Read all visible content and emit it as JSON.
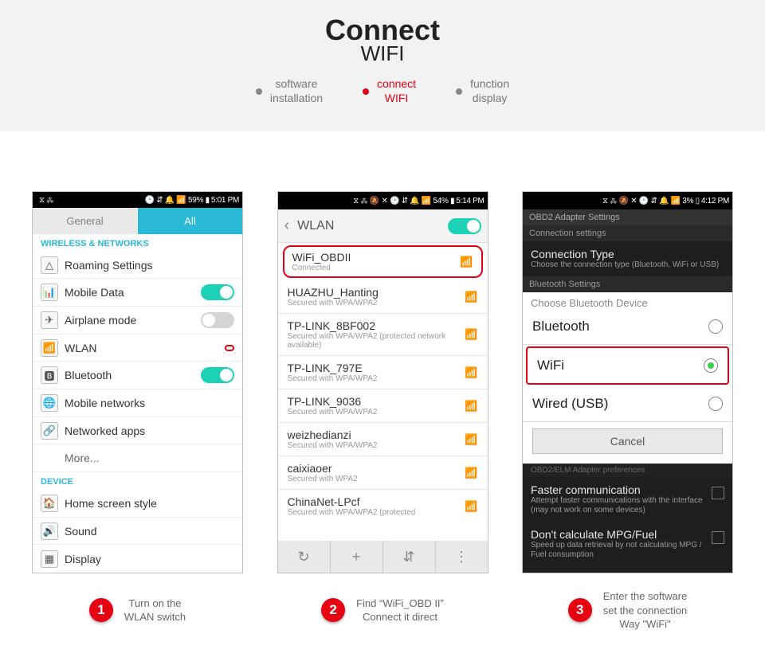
{
  "banner": {
    "title": "Connect",
    "subtitle": "WIFI"
  },
  "bullets": [
    {
      "l1": "software",
      "l2": "installation",
      "active": false
    },
    {
      "l1": "connect",
      "l2": "WIFI",
      "active": true
    },
    {
      "l1": "function",
      "l2": "display",
      "active": false
    }
  ],
  "phone1": {
    "status": {
      "icons": "⧖ ⁂",
      "right": "🕑 ⇵ 🔔 📶 59% ▮",
      "time": "5:01 PM"
    },
    "tabs": {
      "left": "General",
      "right": "All"
    },
    "section1": "WIRELESS & NETWORKS",
    "rows": [
      {
        "icon": "△",
        "label": "Roaming Settings",
        "toggle": null
      },
      {
        "icon": "📊",
        "label": "Mobile Data",
        "toggle": "on"
      },
      {
        "icon": "✈",
        "label": "Airplane mode",
        "toggle": "off"
      },
      {
        "icon": "📶",
        "label": "WLAN",
        "toggle": "on",
        "highlight": true
      },
      {
        "icon": "🅱",
        "label": "Bluetooth",
        "toggle": "on"
      },
      {
        "icon": "🌐",
        "label": "Mobile networks",
        "toggle": null
      },
      {
        "icon": "🔗",
        "label": "Networked apps",
        "toggle": null
      }
    ],
    "more": "More...",
    "section2": "DEVICE",
    "rows2": [
      {
        "icon": "🏠",
        "label": "Home screen style"
      },
      {
        "icon": "🔊",
        "label": "Sound"
      },
      {
        "icon": "▦",
        "label": "Display"
      }
    ]
  },
  "phone2": {
    "status": {
      "right": "⧖ ⁂ 🔕 ✕ 🕑 ⇵ 🔔 📶 54% ▮",
      "time": "5:14 PM"
    },
    "head": {
      "back": "‹",
      "title": "WLAN"
    },
    "first": {
      "name": "WiFi_OBDII",
      "sub": "Connected"
    },
    "nets": [
      {
        "name": "HUAZHU_Hanting",
        "sub": "Secured with WPA/WPA2"
      },
      {
        "name": "TP-LINK_8BF002",
        "sub": "Secured with WPA/WPA2 (protected network available)"
      },
      {
        "name": "TP-LINK_797E",
        "sub": "Secured with WPA/WPA2"
      },
      {
        "name": "TP-LINK_9036",
        "sub": "Secured with WPA/WPA2"
      },
      {
        "name": "weizhedianzi",
        "sub": "Secured with WPA/WPA2"
      },
      {
        "name": "caixiaoer",
        "sub": "Secured with WPA2"
      },
      {
        "name": "ChinaNet-LPcf",
        "sub": "Secured with WPA/WPA2 (protected"
      }
    ],
    "bottom": [
      "↻",
      "+",
      "⇵",
      "⋮"
    ]
  },
  "phone3": {
    "status": {
      "right": "⧖ ⁂ 🔕 ✕ 🕑 ⇵ 🔔 📶 3% ▯",
      "time": "4:12 PM"
    },
    "top": "OBD2 Adapter Settings",
    "sec1": "Connection settings",
    "conn": {
      "title": "Connection Type",
      "sub": "Choose the connection type (Bluetooth, WiFi or USB)"
    },
    "sec2": "Bluetooth Settings",
    "dialog_head": "Choose Bluetooth Device",
    "opts": [
      {
        "name": "Bluetooth",
        "sel": false
      },
      {
        "name": "WiFi",
        "sel": true
      },
      {
        "name": "Wired (USB)",
        "sel": false
      }
    ],
    "cancel": "Cancel",
    "under": "OBD2/ELM Adapter preferences",
    "fast": {
      "title": "Faster communication",
      "sub": "Attempt faster communications with the interface (may not work on some devices)"
    },
    "mpg": {
      "title": "Don't calculate MPG/Fuel",
      "sub": "Speed up data retrieval by not calculating MPG / Fuel consumption"
    }
  },
  "captions": [
    {
      "n": "1",
      "l1": "Turn on the",
      "l2": "WLAN switch"
    },
    {
      "n": "2",
      "l1": "Find  “WiFi_OBD II”",
      "l2": "Connect it direct"
    },
    {
      "n": "3",
      "l1": "Enter the software",
      "l2": "set the connection",
      "l3": "Way \"WiFi\""
    }
  ]
}
